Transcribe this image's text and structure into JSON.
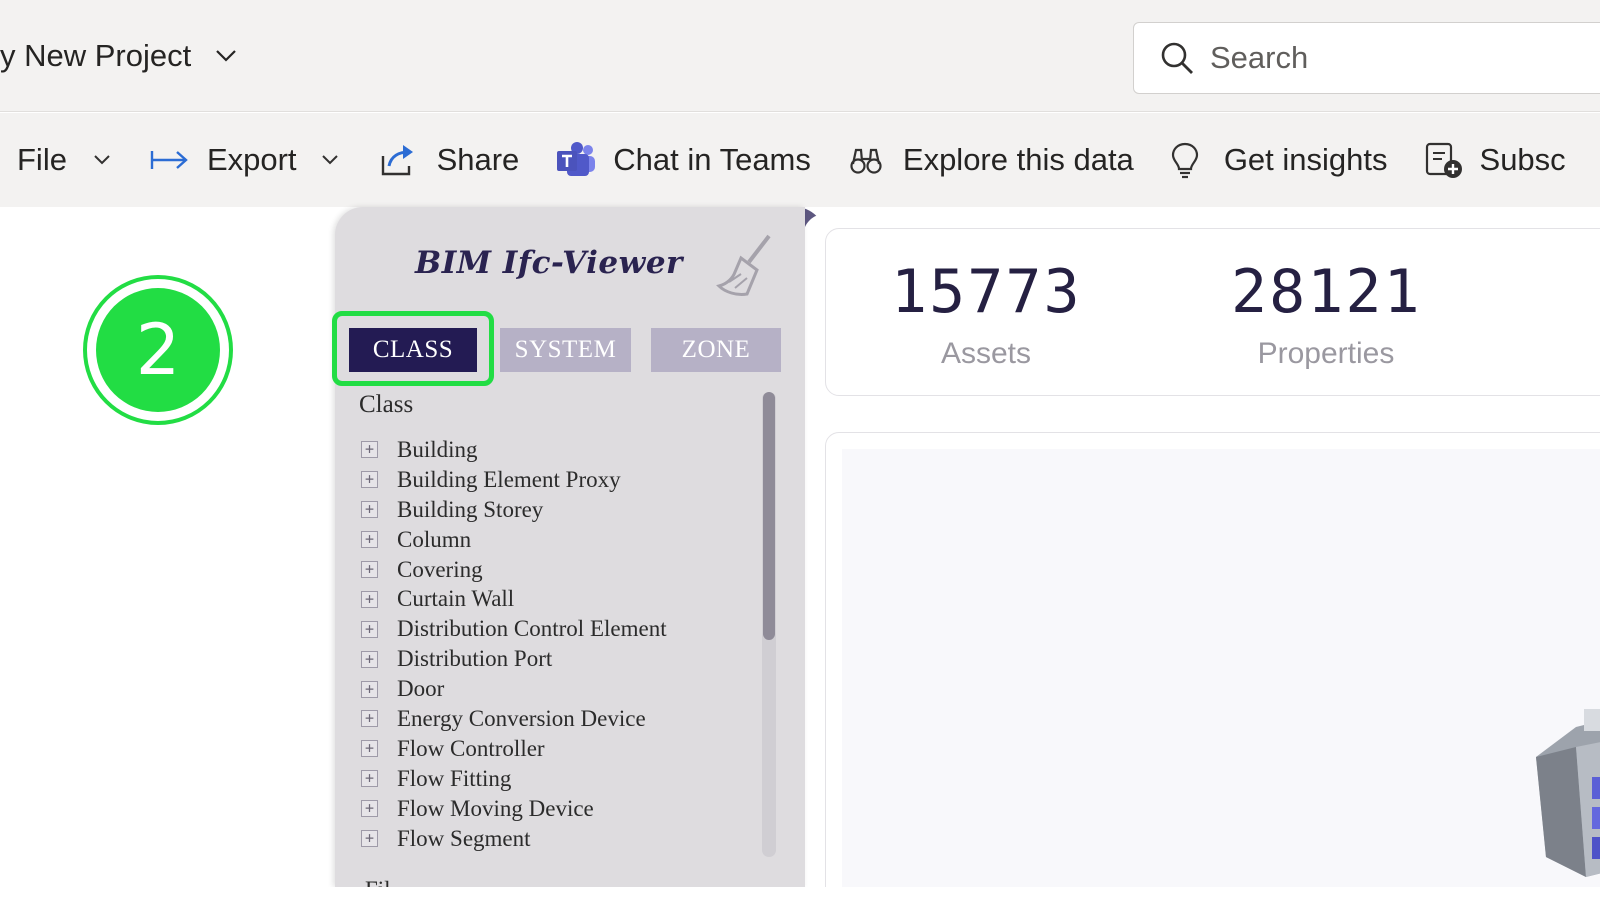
{
  "header": {
    "project_title": "y New Project",
    "search_placeholder": "Search"
  },
  "toolbar": {
    "file": "File",
    "export": "Export",
    "share": "Share",
    "chat_in_teams": "Chat in Teams",
    "explore": "Explore this data",
    "insights": "Get insights",
    "subscribe": "Subsc"
  },
  "annotation": {
    "step_number": "2",
    "highlight_color": "#22dd44"
  },
  "bim_viewer": {
    "title": "BIM Ifc-Viewer",
    "tabs": [
      {
        "label": "CLASS",
        "active": true
      },
      {
        "label": "SYSTEM",
        "active": false
      },
      {
        "label": "ZONE",
        "active": false
      }
    ],
    "tree_header": "Class",
    "items": [
      "Building",
      "Building Element Proxy",
      "Building Storey",
      "Column",
      "Covering",
      "Curtain Wall",
      "Distribution Control Element",
      "Distribution Port",
      "Door",
      "Energy Conversion Device",
      "Flow Controller",
      "Flow Fitting",
      "Flow Moving Device",
      "Flow Segment"
    ],
    "next_item_partial": "Fil"
  },
  "kpis": [
    {
      "value": "15773",
      "label": "Assets"
    },
    {
      "value": "28121",
      "label": "Properties"
    }
  ],
  "colors": {
    "accent_dark": "#231b53",
    "tab_inactive": "#b6b1c6",
    "panel_bg": "#dedcdf",
    "kpi_text": "#252042"
  }
}
